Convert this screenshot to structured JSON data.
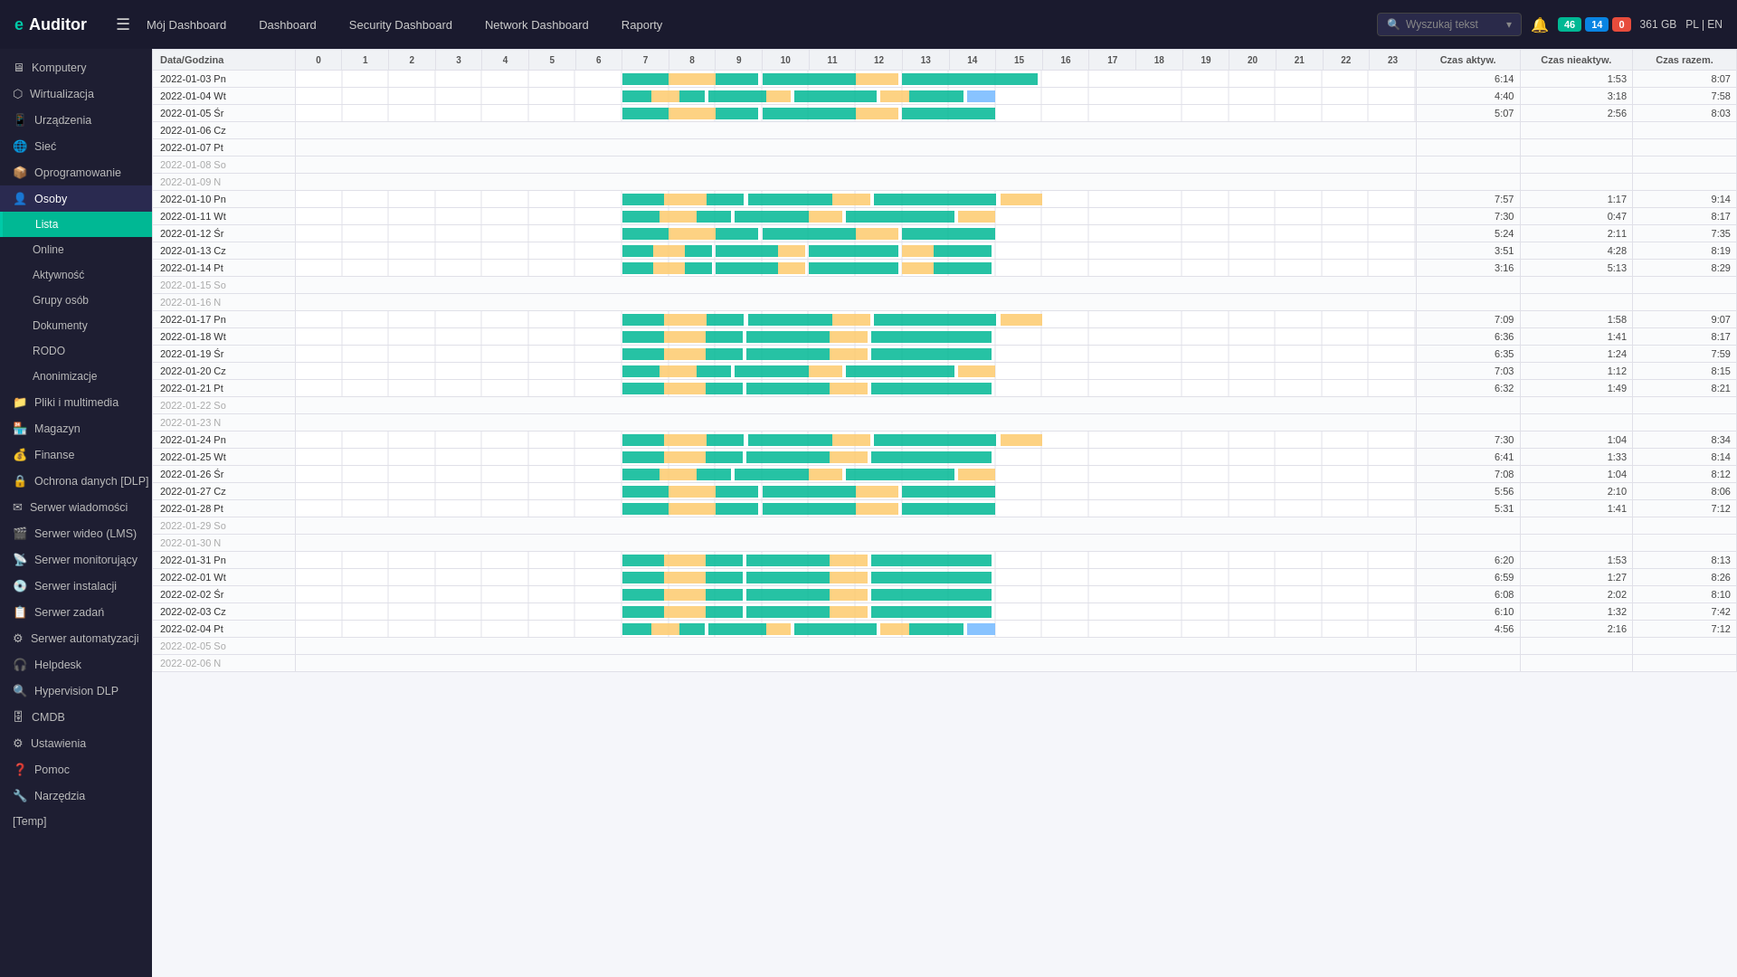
{
  "topnav": {
    "logo": "eAuditor",
    "hamburger": "☰",
    "links": [
      {
        "id": "moj-dashboard",
        "label": "Mój Dashboard",
        "active": false
      },
      {
        "id": "dashboard",
        "label": "Dashboard",
        "active": false
      },
      {
        "id": "security-dashboard",
        "label": "Security Dashboard",
        "active": false
      },
      {
        "id": "network-dashboard",
        "label": "Network Dashboard",
        "active": false
      },
      {
        "id": "raporty",
        "label": "Raporty",
        "active": false
      }
    ],
    "search_placeholder": "Wyszukaj tekst",
    "badges": [
      {
        "label": "46",
        "type": "teal"
      },
      {
        "label": "14",
        "type": "blue"
      },
      {
        "label": "0",
        "type": "red"
      }
    ],
    "storage": "361 GB",
    "lang": "PL | EN"
  },
  "sidebar": {
    "items": [
      {
        "id": "komputery",
        "label": "Komputery",
        "icon": "🖥",
        "sub": false
      },
      {
        "id": "wirtualizacja",
        "label": "Wirtualizacja",
        "icon": "⬡",
        "sub": false
      },
      {
        "id": "urzadzenia",
        "label": "Urządzenia",
        "icon": "📱",
        "sub": false
      },
      {
        "id": "siec",
        "label": "Sieć",
        "icon": "🌐",
        "sub": false
      },
      {
        "id": "oprogramowanie",
        "label": "Oprogramowanie",
        "icon": "📦",
        "sub": false
      },
      {
        "id": "osoby",
        "label": "Osoby",
        "icon": "👤",
        "sub": false,
        "active": true
      },
      {
        "id": "lista",
        "label": "Lista",
        "sub": true,
        "active": true
      },
      {
        "id": "online",
        "label": "Online",
        "sub": true
      },
      {
        "id": "aktywnosc",
        "label": "Aktywność",
        "sub": true
      },
      {
        "id": "grupy-osob",
        "label": "Grupy osób",
        "sub": true
      },
      {
        "id": "dokumenty",
        "label": "Dokumenty",
        "sub": true
      },
      {
        "id": "rodo",
        "label": "RODO",
        "sub": true
      },
      {
        "id": "anonimizacje",
        "label": "Anonimizacje",
        "sub": true
      },
      {
        "id": "pliki-i-multimedia",
        "label": "Pliki i multimedia",
        "icon": "📁",
        "sub": false
      },
      {
        "id": "magazyn",
        "label": "Magazyn",
        "icon": "🏪",
        "sub": false
      },
      {
        "id": "finanse",
        "label": "Finanse",
        "icon": "💰",
        "sub": false
      },
      {
        "id": "ochrona-danych",
        "label": "Ochrona danych [DLP]",
        "icon": "🔒",
        "sub": false
      },
      {
        "id": "serwer-wiadomosci",
        "label": "Serwer wiadomości",
        "icon": "✉",
        "sub": false
      },
      {
        "id": "serwer-wideo",
        "label": "Serwer wideo (LMS)",
        "icon": "🎬",
        "sub": false
      },
      {
        "id": "serwer-monitorujacy",
        "label": "Serwer monitorujący",
        "icon": "📡",
        "sub": false
      },
      {
        "id": "serwer-instalacji",
        "label": "Serwer instalacji",
        "icon": "💿",
        "sub": false
      },
      {
        "id": "serwer-zadan",
        "label": "Serwer zadań",
        "icon": "📋",
        "sub": false
      },
      {
        "id": "serwer-automatyzacji",
        "label": "Serwer automatyzacji",
        "icon": "⚙",
        "sub": false
      },
      {
        "id": "helpdesk",
        "label": "Helpdesk",
        "icon": "🎧",
        "sub": false
      },
      {
        "id": "hypervision-dlp",
        "label": "Hypervision DLP",
        "icon": "🔍",
        "sub": false
      },
      {
        "id": "cmdb",
        "label": "CMDB",
        "icon": "🗄",
        "sub": false
      },
      {
        "id": "ustawienia",
        "label": "Ustawienia",
        "icon": "⚙",
        "sub": false
      },
      {
        "id": "pomoc",
        "label": "Pomoc",
        "icon": "❓",
        "sub": false
      },
      {
        "id": "narzedzia",
        "label": "Narzędzia",
        "icon": "🔧",
        "sub": false
      },
      {
        "id": "temp",
        "label": "[Temp]",
        "sub": false
      }
    ]
  },
  "table": {
    "headers": {
      "date": "Data/Godzina",
      "hours": [
        "0",
        "1",
        "2",
        "3",
        "4",
        "5",
        "6",
        "7",
        "8",
        "9",
        "10",
        "11",
        "12",
        "13",
        "14",
        "15",
        "16",
        "17",
        "18",
        "19",
        "20",
        "21",
        "22",
        "23"
      ],
      "active": "Czas aktyw.",
      "inactive": "Czas nieaktyw.",
      "total": "Czas razem."
    },
    "rows": [
      {
        "date": "2022-01-03 Pn",
        "weekend": false,
        "active": "6:14",
        "inactive": "1:53",
        "total": "8:07",
        "has_data": true,
        "bar_start": 7,
        "bar_end": 16
      },
      {
        "date": "2022-01-04 Wt",
        "weekend": false,
        "active": "4:40",
        "inactive": "3:18",
        "total": "7:58",
        "has_data": true,
        "bar_start": 7,
        "bar_end": 15
      },
      {
        "date": "2022-01-05 Śr",
        "weekend": false,
        "active": "5:07",
        "inactive": "2:56",
        "total": "8:03",
        "has_data": true,
        "bar_start": 7,
        "bar_end": 15
      },
      {
        "date": "2022-01-06 Cz",
        "weekend": false,
        "active": "",
        "inactive": "",
        "total": "",
        "has_data": false
      },
      {
        "date": "2022-01-07 Pt",
        "weekend": false,
        "active": "",
        "inactive": "",
        "total": "",
        "has_data": false
      },
      {
        "date": "2022-01-08 So",
        "weekend": true,
        "active": "",
        "inactive": "",
        "total": "",
        "has_data": false
      },
      {
        "date": "2022-01-09 N",
        "weekend": true,
        "active": "",
        "inactive": "",
        "total": "",
        "has_data": false
      },
      {
        "date": "2022-01-10 Pn",
        "weekend": false,
        "active": "7:57",
        "inactive": "1:17",
        "total": "9:14",
        "has_data": true,
        "bar_start": 7,
        "bar_end": 16
      },
      {
        "date": "2022-01-11 Wt",
        "weekend": false,
        "active": "7:30",
        "inactive": "0:47",
        "total": "8:17",
        "has_data": true,
        "bar_start": 7,
        "bar_end": 15
      },
      {
        "date": "2022-01-12 Śr",
        "weekend": false,
        "active": "5:24",
        "inactive": "2:11",
        "total": "7:35",
        "has_data": true,
        "bar_start": 7,
        "bar_end": 15
      },
      {
        "date": "2022-01-13 Cz",
        "weekend": false,
        "active": "3:51",
        "inactive": "4:28",
        "total": "8:19",
        "has_data": true,
        "bar_start": 7,
        "bar_end": 15
      },
      {
        "date": "2022-01-14 Pt",
        "weekend": false,
        "active": "3:16",
        "inactive": "5:13",
        "total": "8:29",
        "has_data": true,
        "bar_start": 7,
        "bar_end": 15
      },
      {
        "date": "2022-01-15 So",
        "weekend": true,
        "active": "",
        "inactive": "",
        "total": "",
        "has_data": false
      },
      {
        "date": "2022-01-16 N",
        "weekend": true,
        "active": "",
        "inactive": "",
        "total": "",
        "has_data": false
      },
      {
        "date": "2022-01-17 Pn",
        "weekend": false,
        "active": "7:09",
        "inactive": "1:58",
        "total": "9:07",
        "has_data": true,
        "bar_start": 7,
        "bar_end": 16
      },
      {
        "date": "2022-01-18 Wt",
        "weekend": false,
        "active": "6:36",
        "inactive": "1:41",
        "total": "8:17",
        "has_data": true,
        "bar_start": 7,
        "bar_end": 15
      },
      {
        "date": "2022-01-19 Śr",
        "weekend": false,
        "active": "6:35",
        "inactive": "1:24",
        "total": "7:59",
        "has_data": true,
        "bar_start": 7,
        "bar_end": 15
      },
      {
        "date": "2022-01-20 Cz",
        "weekend": false,
        "active": "7:03",
        "inactive": "1:12",
        "total": "8:15",
        "has_data": true,
        "bar_start": 7,
        "bar_end": 15
      },
      {
        "date": "2022-01-21 Pt",
        "weekend": false,
        "active": "6:32",
        "inactive": "1:49",
        "total": "8:21",
        "has_data": true,
        "bar_start": 7,
        "bar_end": 15
      },
      {
        "date": "2022-01-22 So",
        "weekend": true,
        "active": "",
        "inactive": "",
        "total": "",
        "has_data": false
      },
      {
        "date": "2022-01-23 N",
        "weekend": true,
        "active": "",
        "inactive": "",
        "total": "",
        "has_data": false
      },
      {
        "date": "2022-01-24 Pn",
        "weekend": false,
        "active": "7:30",
        "inactive": "1:04",
        "total": "8:34",
        "has_data": true,
        "bar_start": 7,
        "bar_end": 16
      },
      {
        "date": "2022-01-25 Wt",
        "weekend": false,
        "active": "6:41",
        "inactive": "1:33",
        "total": "8:14",
        "has_data": true,
        "bar_start": 7,
        "bar_end": 15
      },
      {
        "date": "2022-01-26 Śr",
        "weekend": false,
        "active": "7:08",
        "inactive": "1:04",
        "total": "8:12",
        "has_data": true,
        "bar_start": 7,
        "bar_end": 15
      },
      {
        "date": "2022-01-27 Cz",
        "weekend": false,
        "active": "5:56",
        "inactive": "2:10",
        "total": "8:06",
        "has_data": true,
        "bar_start": 7,
        "bar_end": 15
      },
      {
        "date": "2022-01-28 Pt",
        "weekend": false,
        "active": "5:31",
        "inactive": "1:41",
        "total": "7:12",
        "has_data": true,
        "bar_start": 7,
        "bar_end": 15
      },
      {
        "date": "2022-01-29 So",
        "weekend": true,
        "active": "",
        "inactive": "",
        "total": "",
        "has_data": false
      },
      {
        "date": "2022-01-30 N",
        "weekend": true,
        "active": "",
        "inactive": "",
        "total": "",
        "has_data": false
      },
      {
        "date": "2022-01-31 Pn",
        "weekend": false,
        "active": "6:20",
        "inactive": "1:53",
        "total": "8:13",
        "has_data": true,
        "bar_start": 7,
        "bar_end": 15
      },
      {
        "date": "2022-02-01 Wt",
        "weekend": false,
        "active": "6:59",
        "inactive": "1:27",
        "total": "8:26",
        "has_data": true,
        "bar_start": 7,
        "bar_end": 15
      },
      {
        "date": "2022-02-02 Śr",
        "weekend": false,
        "active": "6:08",
        "inactive": "2:02",
        "total": "8:10",
        "has_data": true,
        "bar_start": 7,
        "bar_end": 15
      },
      {
        "date": "2022-02-03 Cz",
        "weekend": false,
        "active": "6:10",
        "inactive": "1:32",
        "total": "7:42",
        "has_data": true,
        "bar_start": 7,
        "bar_end": 15
      },
      {
        "date": "2022-02-04 Pt",
        "weekend": false,
        "active": "4:56",
        "inactive": "2:16",
        "total": "7:12",
        "has_data": true,
        "bar_start": 7,
        "bar_end": 15
      },
      {
        "date": "2022-02-05 So",
        "weekend": true,
        "active": "",
        "inactive": "",
        "total": "",
        "has_data": false
      },
      {
        "date": "2022-02-06 N",
        "weekend": true,
        "active": "",
        "inactive": "",
        "total": "",
        "has_data": false
      }
    ]
  }
}
